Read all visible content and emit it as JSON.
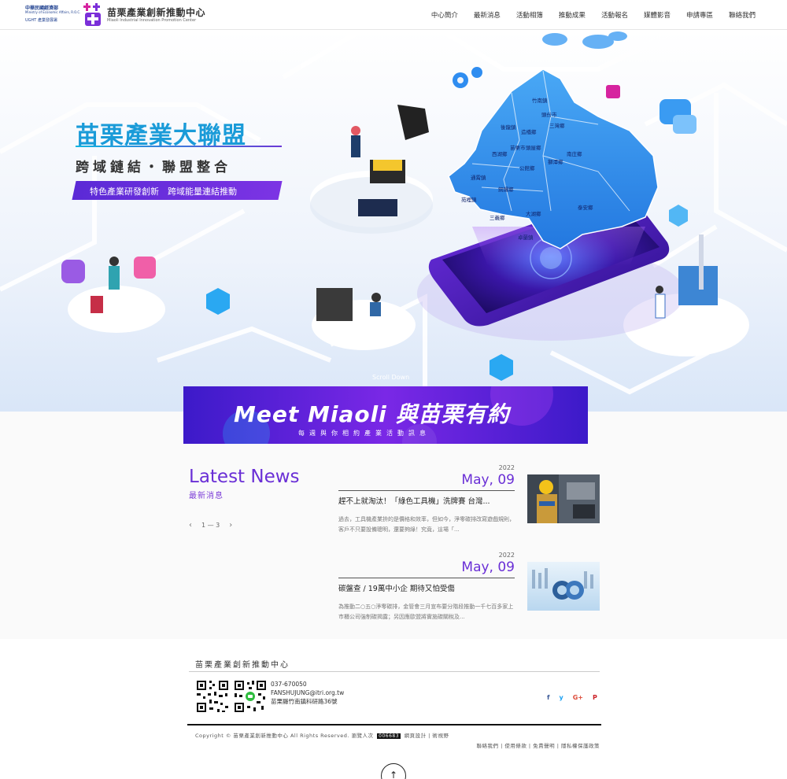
{
  "header": {
    "moea_line1": "中華民國經濟部",
    "moea_line2": "Ministry of Economic Affairs, R.O.C.",
    "moea_line3": "UGHT 產業發展署",
    "brand_title": "苗栗產業創新推動中心",
    "brand_subtitle": "Miaoli Industrial Innovation Promotion Center",
    "nav": [
      "中心簡介",
      "最新消息",
      "活動相簿",
      "推動成果",
      "活動報名",
      "媒體影音",
      "申請專區",
      "聯絡我們"
    ]
  },
  "hero": {
    "title": "苗栗產業大聯盟",
    "subtitle": "跨域鏈結・聯盟整合",
    "tagline": "特色產業研發創新　跨域能量連結推動",
    "scroll_label": "Scroll Down",
    "map_labels": [
      "竹南鎮",
      "頭份市",
      "三灣鄉",
      "南庄鄉",
      "造橋鄉",
      "後龍鎮",
      "苗栗市",
      "頭屋鄉",
      "西湖鄉",
      "公館鄉",
      "獅潭鄉",
      "通霄鎮",
      "銅鑼鄉",
      "泰安鄉",
      "苑裡鎮",
      "三義鄉",
      "大湖鄉",
      "卓蘭鎮"
    ]
  },
  "meet": {
    "title": "Meet Miaoli 與苗栗有約",
    "subtitle": "每週與你相約產業活動訊息"
  },
  "news": {
    "heading": "Latest News",
    "heading_sub": "最新消息",
    "pager": "1 — 3",
    "items": [
      {
        "year": "2022",
        "date": "May, 09",
        "title": "趕不上就淘汰！「綠色工具機」洗牌賽 台灣...",
        "excerpt": "過去，工具機產業拚的是價格和效率，但如今，淨零碳排改寫遊戲規則，客戶不只要設備聰明，還要夠綠！究竟，這場「..."
      },
      {
        "year": "2022",
        "date": "May, 09",
        "title": "碳盤查 / 19萬中小企 期待又怕受傷",
        "excerpt": "為推動二○五○淨零碳排，金管會三月宣布要分階段推動一千七百多家上市櫃公司強制碳揭露；另因應歐盟將實施碳關稅及..."
      }
    ]
  },
  "footer": {
    "title": "苗栗產業創新推動中心",
    "phone": "037-670050",
    "email": "FANSHUJUNG@itri.org.tw",
    "address": "苗栗縣竹南鎮科研路36號",
    "social": [
      "f",
      "y",
      "G+",
      "P"
    ],
    "copyright_pre": "Copyright © 苗栗產業創新推動中心 All Rights Reserved. 瀏覽人次",
    "counter": "006683",
    "copyright_post": "網頁設計 | 術視野",
    "links": "聯絡我們 | 使用條款 | 免責聲明 | 隱私權保護政策",
    "back_top": "↑"
  },
  "colors": {
    "accent": "#6a2fd6",
    "hero_title": "#1a9bd8",
    "map_blue": "#2f95ef"
  }
}
